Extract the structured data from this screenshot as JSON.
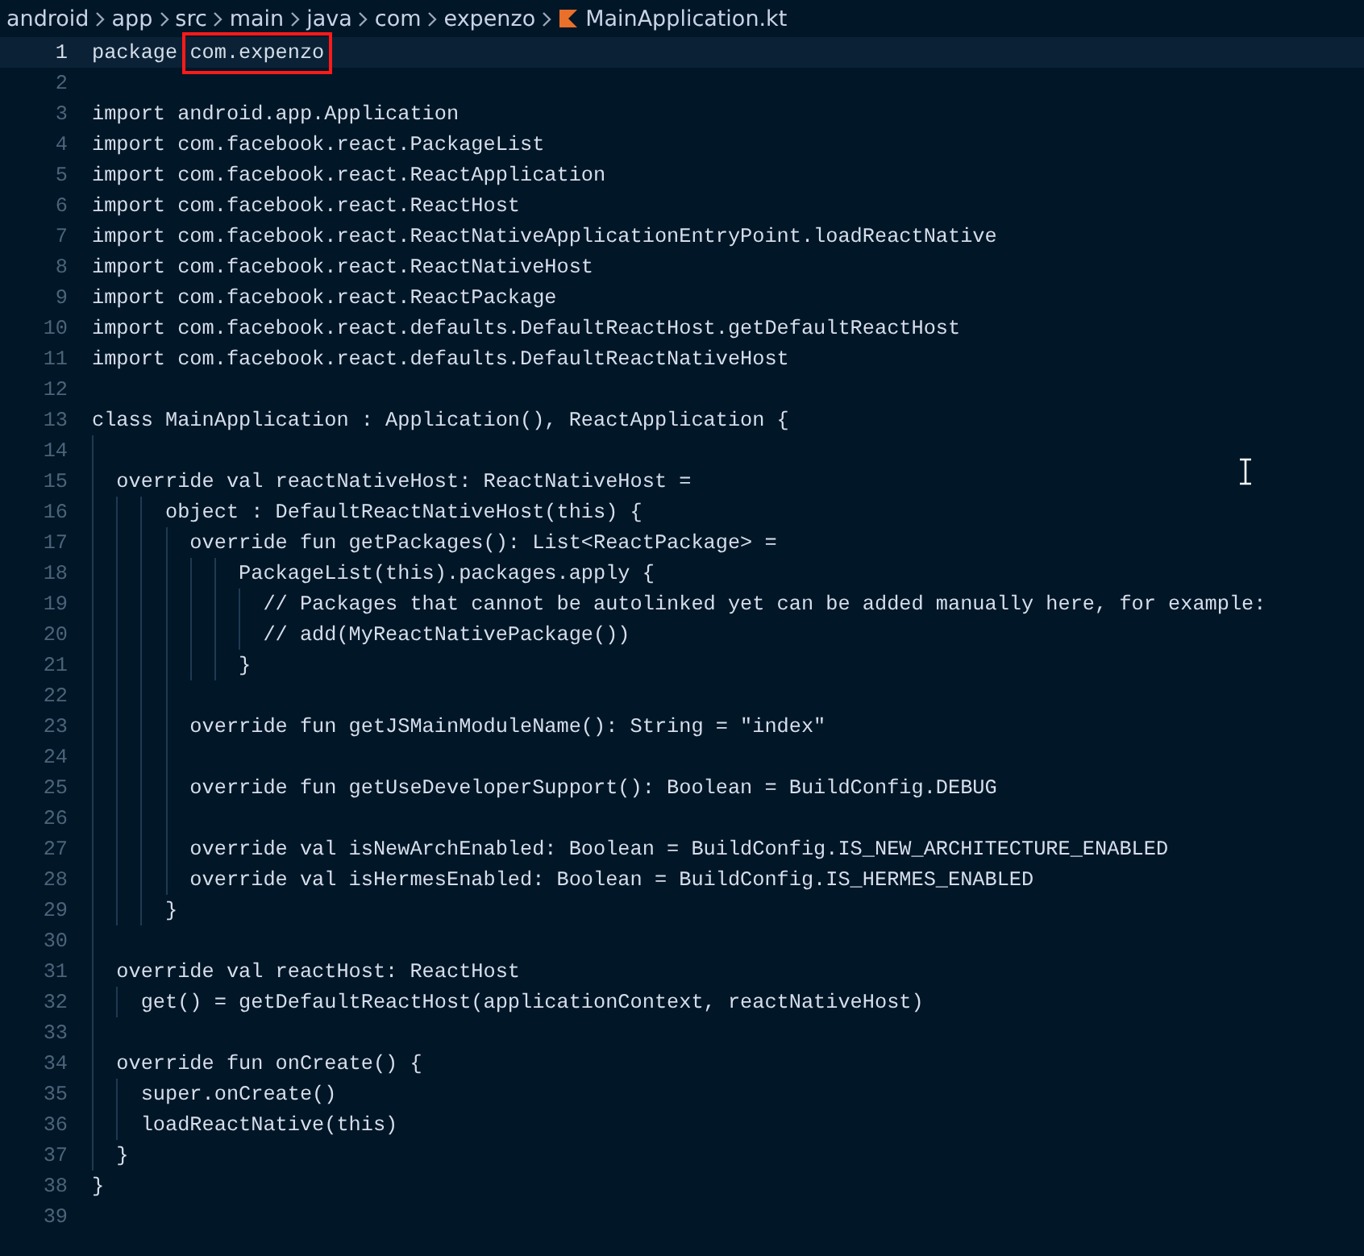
{
  "breadcrumb": [
    {
      "label": "android",
      "kind": "folder"
    },
    {
      "label": "app",
      "kind": "folder"
    },
    {
      "label": "src",
      "kind": "folder"
    },
    {
      "label": "main",
      "kind": "folder"
    },
    {
      "label": "java",
      "kind": "folder"
    },
    {
      "label": "com",
      "kind": "folder"
    },
    {
      "label": "expenzo",
      "kind": "folder"
    },
    {
      "label": "MainApplication.kt",
      "kind": "kotlin-file"
    }
  ],
  "lines": [
    {
      "number": "1",
      "code": "package ",
      "boxed": "com.expenzo",
      "active": true
    },
    {
      "number": "2",
      "active": false
    },
    {
      "number": "3",
      "code": "import android.app.Application",
      "active": false
    },
    {
      "number": "4",
      "code": "import com.facebook.react.PackageList",
      "active": false
    },
    {
      "number": "5",
      "code": "import com.facebook.react.ReactApplication",
      "active": false
    },
    {
      "number": "6",
      "code": "import com.facebook.react.ReactHost",
      "active": false
    },
    {
      "number": "7",
      "code": "import com.facebook.react.ReactNativeApplicationEntryPoint.loadReactNative",
      "active": false
    },
    {
      "number": "8",
      "code": "import com.facebook.react.ReactNativeHost",
      "active": false
    },
    {
      "number": "9",
      "code": "import com.facebook.react.ReactPackage",
      "active": false
    },
    {
      "number": "10",
      "code": "import com.facebook.react.defaults.DefaultReactHost.getDefaultReactHost",
      "active": false
    },
    {
      "number": "11",
      "code": "import com.facebook.react.defaults.DefaultReactNativeHost",
      "active": false
    },
    {
      "number": "12",
      "active": false
    },
    {
      "number": "13",
      "code": "class MainApplication : Application(), ReactApplication {",
      "active": false
    },
    {
      "number": "14",
      "active": false
    },
    {
      "number": "15",
      "code": "  override val reactNativeHost: ReactNativeHost =",
      "active": false
    },
    {
      "number": "16",
      "code": "      object : DefaultReactNativeHost(this) {",
      "active": false
    },
    {
      "number": "17",
      "code": "        override fun getPackages(): List<ReactPackage> =",
      "active": false
    },
    {
      "number": "18",
      "code": "            PackageList(this).packages.apply {",
      "active": false
    },
    {
      "number": "19",
      "code": "              // Packages that cannot be autolinked yet can be added manually here, for example:",
      "active": false
    },
    {
      "number": "20",
      "code": "              // add(MyReactNativePackage())",
      "active": false
    },
    {
      "number": "21",
      "code": "            }",
      "active": false
    },
    {
      "number": "22",
      "active": false
    },
    {
      "number": "23",
      "code": "        override fun getJSMainModuleName(): String = \"index\"",
      "active": false
    },
    {
      "number": "24",
      "active": false
    },
    {
      "number": "25",
      "code": "        override fun getUseDeveloperSupport(): Boolean = BuildConfig.DEBUG",
      "active": false
    },
    {
      "number": "26",
      "active": false
    },
    {
      "number": "27",
      "code": "        override val isNewArchEnabled: Boolean = BuildConfig.IS_NEW_ARCHITECTURE_ENABLED",
      "active": false
    },
    {
      "number": "28",
      "code": "        override val isHermesEnabled: Boolean = BuildConfig.IS_HERMES_ENABLED",
      "active": false
    },
    {
      "number": "29",
      "code": "      }",
      "active": false
    },
    {
      "number": "30",
      "active": false
    },
    {
      "number": "31",
      "code": "  override val reactHost: ReactHost",
      "active": false
    },
    {
      "number": "32",
      "code": "    get() = getDefaultReactHost(applicationContext, reactNativeHost)",
      "active": false
    },
    {
      "number": "33",
      "active": false
    },
    {
      "number": "34",
      "code": "  override fun onCreate() {",
      "active": false
    },
    {
      "number": "35",
      "code": "    super.onCreate()",
      "active": false
    },
    {
      "number": "36",
      "code": "    loadReactNative(this)",
      "active": false
    },
    {
      "number": "37",
      "code": "  }",
      "active": false
    },
    {
      "number": "38",
      "code": "}",
      "active": false
    },
    {
      "number": "39",
      "active": false
    }
  ]
}
